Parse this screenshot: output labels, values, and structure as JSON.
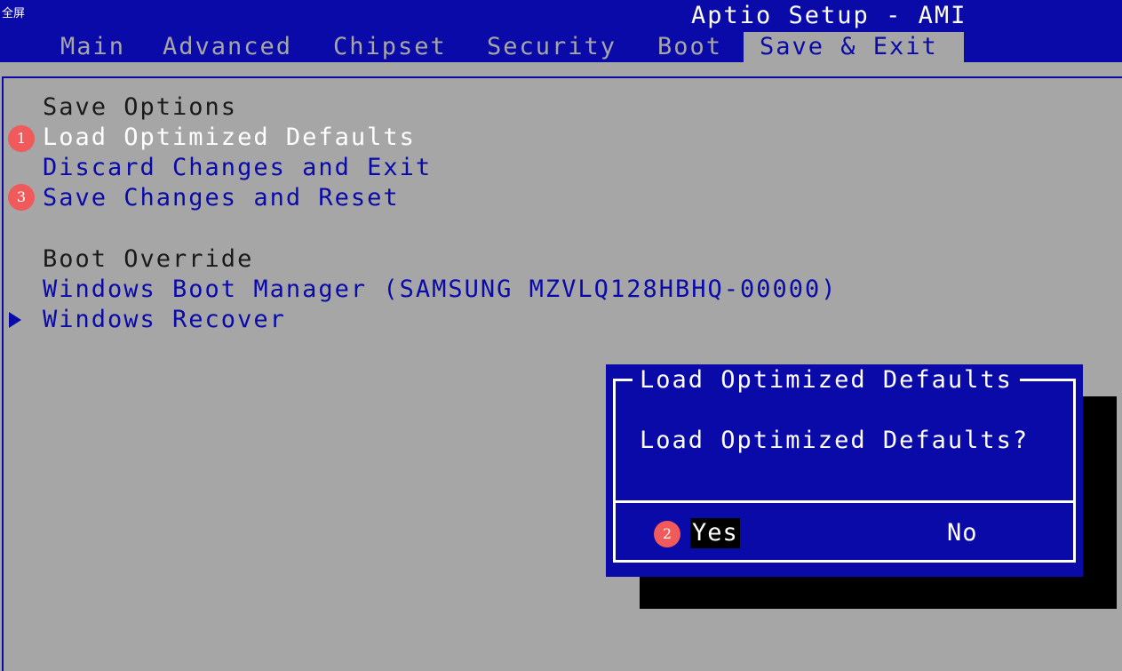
{
  "top_label": "全屏",
  "header": {
    "title": "Aptio Setup - AMI",
    "tabs": [
      {
        "label": "Main"
      },
      {
        "label": "Advanced"
      },
      {
        "label": "Chipset"
      },
      {
        "label": "Security"
      },
      {
        "label": "Boot"
      },
      {
        "label": "Save & Exit"
      }
    ],
    "active_tab": "Save & Exit"
  },
  "menu": {
    "save_options": {
      "heading": "Save Options",
      "items": [
        {
          "label": "Load Optimized Defaults",
          "selected": true
        },
        {
          "label": "Discard Changes and Exit"
        },
        {
          "label": "Save Changes and Reset"
        }
      ]
    },
    "boot_override": {
      "heading": "Boot Override",
      "items": [
        {
          "label": "Windows Boot Manager (SAMSUNG MZVLQ128HBHQ-00000)"
        },
        {
          "label": "Windows Recover",
          "has_submenu": true
        }
      ]
    }
  },
  "annotations": [
    "1",
    "2",
    "3"
  ],
  "dialog": {
    "title": "Load Optimized Defaults",
    "message": "Load Optimized Defaults?",
    "yes_label": "Yes",
    "no_label": "No",
    "focused": "Yes"
  },
  "colors": {
    "bios_blue": "#0a0aa8",
    "background_gray": "#a6a6a6",
    "annotation_red": "#f05a5a",
    "text_white": "#ffffff"
  },
  "icons": {
    "submenu_pointer": "triangle-right-icon"
  }
}
